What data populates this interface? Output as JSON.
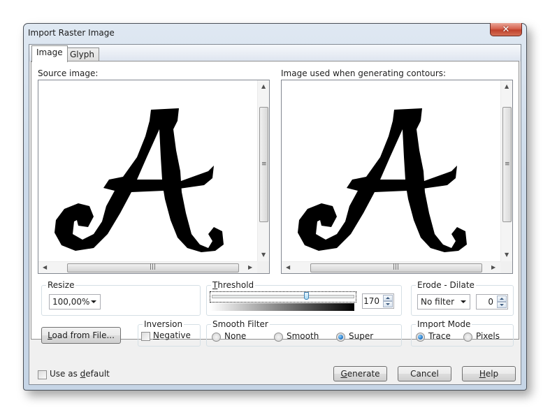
{
  "window": {
    "title": "Import Raster Image",
    "close_icon": "close-icon"
  },
  "tabs": [
    {
      "label": "Image",
      "active": true
    },
    {
      "label": "Glyph",
      "active": false
    }
  ],
  "source_panel": {
    "label": "Source image:",
    "content": "letter-A-glyph"
  },
  "contour_panel": {
    "label": "Image used when generating contours:",
    "content": "letter-A-glyph-thresholded"
  },
  "resize": {
    "title": "Resize",
    "value": "100,00%"
  },
  "threshold": {
    "title_prefix": "",
    "title_ul": "T",
    "title_rest": "hreshold",
    "value": "170",
    "max": 255
  },
  "erode_dilate": {
    "title": "Erode - Dilate",
    "filter": "No filter",
    "amount": "0"
  },
  "load_button": {
    "ul": "L",
    "rest": "oad from File..."
  },
  "inversion": {
    "title": "Inversion",
    "checkbox_ul": "N",
    "checkbox_rest": "egative",
    "checked": false
  },
  "smooth_filter": {
    "title": "Smooth Filter",
    "options": [
      "None",
      "Smooth",
      "Super"
    ],
    "selected": "Super"
  },
  "import_mode": {
    "title": "Import Mode",
    "options": [
      "Trace",
      "Pixels"
    ],
    "selected": "Trace"
  },
  "footer": {
    "use_default": {
      "pre": "Use as ",
      "ul": "d",
      "post": "efault",
      "checked": false
    },
    "generate": {
      "ul": "G",
      "rest": "enerate"
    },
    "cancel": "Cancel",
    "help": {
      "ul": "H",
      "rest": "elp"
    }
  }
}
